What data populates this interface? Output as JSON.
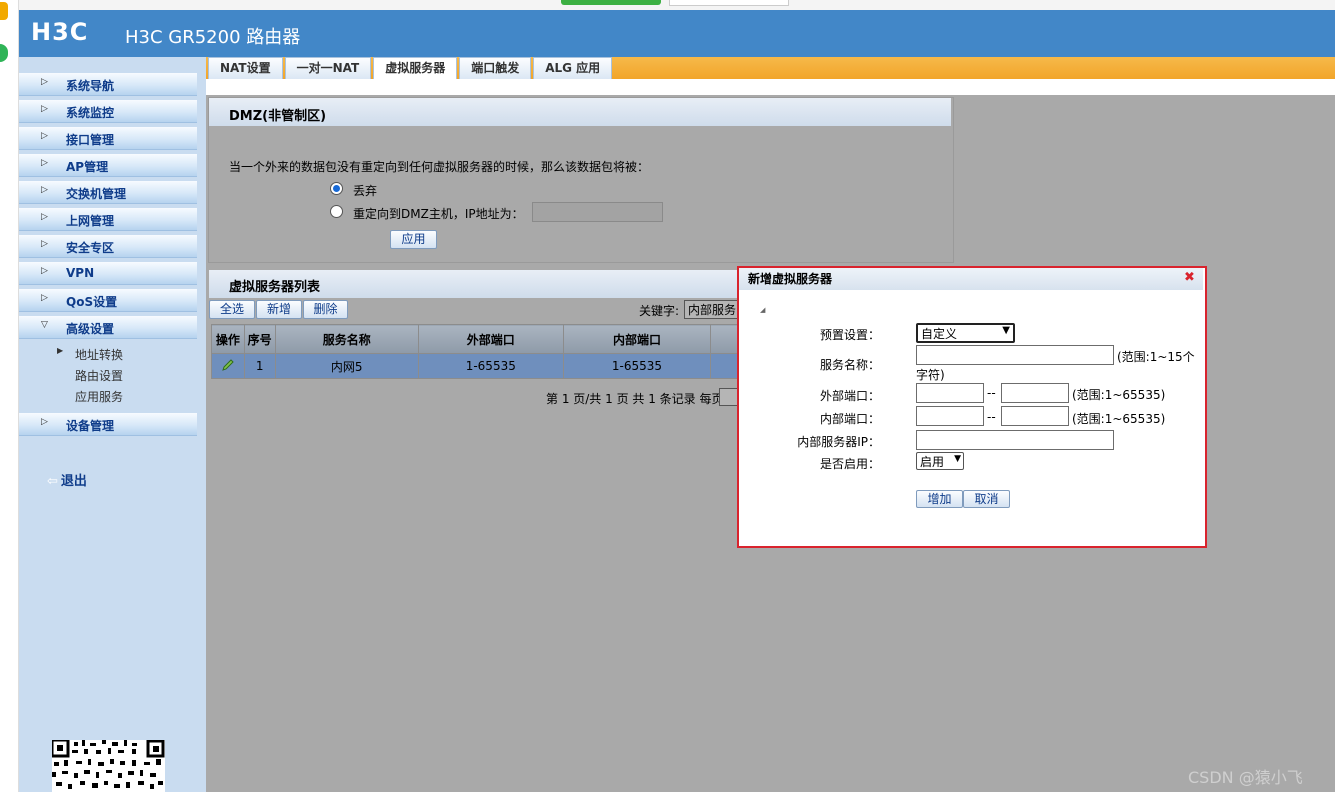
{
  "header": {
    "logo": "H3C",
    "model": "H3C GR5200 路由器"
  },
  "sidebar": {
    "items": [
      {
        "label": "系统导航"
      },
      {
        "label": "系统监控"
      },
      {
        "label": "接口管理"
      },
      {
        "label": "AP管理"
      },
      {
        "label": "交换机管理"
      },
      {
        "label": "上网管理"
      },
      {
        "label": "安全专区"
      },
      {
        "label": "VPN"
      },
      {
        "label": "QoS设置"
      },
      {
        "label": "高级设置"
      }
    ],
    "subitems": [
      {
        "label": "地址转换"
      },
      {
        "label": "路由设置"
      },
      {
        "label": "应用服务"
      }
    ],
    "last_item": {
      "label": "设备管理"
    },
    "logout": "退出"
  },
  "tabs": [
    {
      "label": "NAT设置"
    },
    {
      "label": "一对一NAT"
    },
    {
      "label": "虚拟服务器"
    },
    {
      "label": "端口触发"
    },
    {
      "label": "ALG 应用"
    }
  ],
  "dmz": {
    "title": "DMZ(非管制区)",
    "description": "当一个外来的数据包没有重定向到任何虚拟服务器的时候，那么该数据包将被：",
    "option_drop": "丢弃",
    "option_redirect": "重定向到DMZ主机，IP地址为：",
    "ip_value": "",
    "apply": "应用"
  },
  "vs_list": {
    "title": "虚拟服务器列表",
    "select_all": "全选",
    "add": "新增",
    "delete": "删除",
    "keyword_label": "关键字:",
    "keyword_value": "内部服务",
    "columns": [
      "操作",
      "序号",
      "服务名称",
      "外部端口",
      "内部端口"
    ],
    "rows": [
      {
        "index": "1",
        "name": "内网5",
        "ext_port": "1-65535",
        "int_port": "1-65535"
      }
    ],
    "pagination": "第 1 页/共 1 页 共 1 条记录 每页"
  },
  "dialog": {
    "title": "新增虚拟服务器",
    "preset_label": "预置设置：",
    "preset_value": "自定义",
    "name_label": "服务名称：",
    "name_hint_1": "(范围:1~15个",
    "name_hint_2": "字符)",
    "ext_port_label": "外部端口：",
    "int_port_label": "内部端口：",
    "port_sep": "--",
    "port_hint": "(范围:1~65535)",
    "server_ip_label": "内部服务器IP：",
    "enable_label": "是否启用：",
    "enable_value": "启用",
    "add_btn": "增加",
    "cancel_btn": "取消"
  },
  "watermark": "CSDN @猿小飞"
}
